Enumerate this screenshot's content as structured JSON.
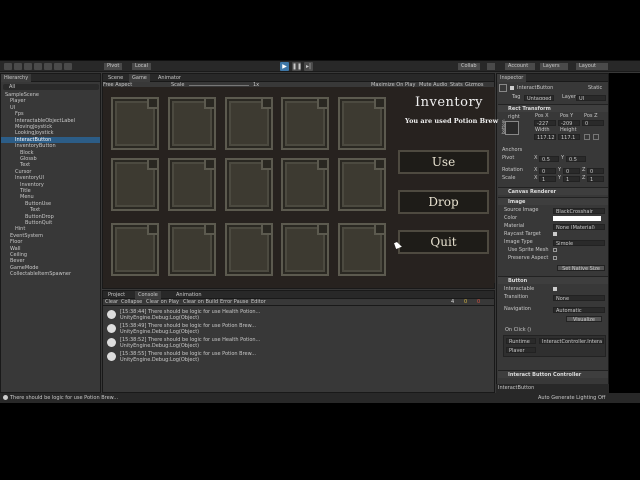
{
  "toolbar": {
    "pivot_label": "Pivot",
    "local_label": "Local",
    "collab_label": "Collab",
    "account_label": "Account",
    "layers_label": "Layers",
    "layout_label": "Layout"
  },
  "hierarchy": {
    "tab_label": "Hierarchy",
    "search_placeholder": "All",
    "items": [
      {
        "label": "SampleScene",
        "indent": 0,
        "selected": false
      },
      {
        "label": "Player",
        "indent": 1,
        "selected": false
      },
      {
        "label": "UI",
        "indent": 1,
        "selected": false
      },
      {
        "label": "Fps",
        "indent": 2,
        "selected": false
      },
      {
        "label": "InteractableObjectLabel",
        "indent": 2,
        "selected": false
      },
      {
        "label": "MovingJoystick",
        "indent": 2,
        "selected": false
      },
      {
        "label": "LookingJoystick",
        "indent": 2,
        "selected": false
      },
      {
        "label": "InteractButton",
        "indent": 2,
        "selected": true
      },
      {
        "label": "InventoryButton",
        "indent": 2,
        "selected": false
      },
      {
        "label": "Block",
        "indent": 3,
        "selected": false
      },
      {
        "label": "Glossb",
        "indent": 3,
        "selected": false
      },
      {
        "label": "Text",
        "indent": 3,
        "selected": false
      },
      {
        "label": "Cursor",
        "indent": 2,
        "selected": false
      },
      {
        "label": "InventoryUI",
        "indent": 2,
        "selected": false
      },
      {
        "label": "Inventory",
        "indent": 3,
        "selected": false
      },
      {
        "label": "Title",
        "indent": 3,
        "selected": false
      },
      {
        "label": "Menu",
        "indent": 3,
        "selected": false
      },
      {
        "label": "ButtonUse",
        "indent": 4,
        "selected": false
      },
      {
        "label": "Text",
        "indent": 5,
        "selected": false
      },
      {
        "label": "ButtonDrop",
        "indent": 4,
        "selected": false
      },
      {
        "label": "ButtonQuit",
        "indent": 4,
        "selected": false
      },
      {
        "label": "Hint",
        "indent": 2,
        "selected": false
      },
      {
        "label": "EventSystem",
        "indent": 1,
        "selected": false
      },
      {
        "label": "Floor",
        "indent": 1,
        "selected": false
      },
      {
        "label": "Wall",
        "indent": 1,
        "selected": false
      },
      {
        "label": "Ceiling",
        "indent": 1,
        "selected": false
      },
      {
        "label": "Bever",
        "indent": 1,
        "selected": false
      },
      {
        "label": "GameMode",
        "indent": 1,
        "selected": false
      },
      {
        "label": "CollectableItemSpawner",
        "indent": 1,
        "selected": false
      }
    ]
  },
  "scene_tabs": {
    "scene": "Scene",
    "game": "Game",
    "animator": "Animator"
  },
  "game_toolbar": {
    "aspect": "Free Aspect",
    "scale_label": "Scale",
    "scale_value": "1x",
    "maximize": "Maximize On Play",
    "mute": "Mute Audio",
    "stats": "Stats",
    "gizmos": "Gizmos"
  },
  "game": {
    "inventory_title": "Inventory",
    "used_message": "You are used Potion Brew",
    "use_button": "Use",
    "drop_button": "Drop",
    "quit_button": "Quit"
  },
  "console": {
    "tab_project": "Project",
    "tab_console": "Console",
    "tab_animation": "Animation",
    "clear": "Clear",
    "collapse": "Collapse",
    "clear_on_play": "Clear on Play",
    "clear_on_build": "Clear on Build",
    "error_pause": "Error Pause",
    "editor": "Editor",
    "count_logs": "4",
    "count_warnings": "0",
    "count_errors": "0",
    "logs": [
      {
        "line1": "[15:38:44] There should be logic for use Health Potion...",
        "line2": "UnityEngine.Debug:Log(Object)"
      },
      {
        "line1": "[15:38:49] There should be logic for use Potion Brew...",
        "line2": "UnityEngine.Debug:Log(Object)"
      },
      {
        "line1": "[15:38:52] There should be logic for use Health Potion...",
        "line2": "UnityEngine.Debug:Log(Object)"
      },
      {
        "line1": "[15:38:55] There should be logic for use Potion Brew...",
        "line2": "UnityEngine.Debug:Log(Object)"
      }
    ]
  },
  "inspector": {
    "tab_label": "Inspector",
    "object_name": "InteractButton",
    "static_label": "Static",
    "tag_label": "Tag",
    "tag_value": "Untagged",
    "layer_label": "Layer",
    "layer_value": "UI",
    "rect_transform": "Rect Transform",
    "anchor_h": "right",
    "anchor_v": "bottom",
    "posx_label": "Pos X",
    "posy_label": "Pos Y",
    "posz_label": "Pos Z",
    "posx": "-227",
    "posy": "-209",
    "posz": "0",
    "width_label": "Width",
    "height_label": "Height",
    "width": "117.12",
    "height": "117.1",
    "anchors_label": "Anchors",
    "pivot_row_label": "Pivot",
    "pivot_x": "0.5",
    "pivot_y": "0.5",
    "rotation_label": "Rotation",
    "rot_x": "0",
    "rot_y": "0",
    "rot_z": "0",
    "scale_label": "Scale",
    "scale_x": "1",
    "scale_y": "1",
    "scale_z": "1",
    "canvas_renderer": "Canvas Renderer",
    "image_header": "Image",
    "source_image_label": "Source Image",
    "source_image_value": "BlackCrosshair",
    "color_label": "Color",
    "material_label": "Material",
    "material_value": "None (Material)",
    "raycast_label": "Raycast Target",
    "image_type_label": "Image Type",
    "image_type_value": "Simple",
    "use_sprite_mesh": "Use Sprite Mesh",
    "preserve_aspect": "Preserve Aspect",
    "set_native": "Set Native Size",
    "button_header": "Button",
    "interactable_label": "Interactable",
    "transition_label": "Transition",
    "transition_value": "None",
    "navigation_label": "Navigation",
    "navigation_value": "Automatic",
    "visualize": "Visualize",
    "onclick_label": "On Click ()",
    "runtime_value": "Runtime",
    "function_value": "InteractController.Intera",
    "player_value": "Player",
    "interact_controller": "Interact Button Controller",
    "footer_label": "InteractButton"
  },
  "status_bar": {
    "message": "There should be logic for use Potion Brew...",
    "lighting": "Auto Generate Lighting Off"
  },
  "colors": {
    "selection": "#2c5d87",
    "play_active": "#3d76a6",
    "editor_bg": "#383838"
  }
}
